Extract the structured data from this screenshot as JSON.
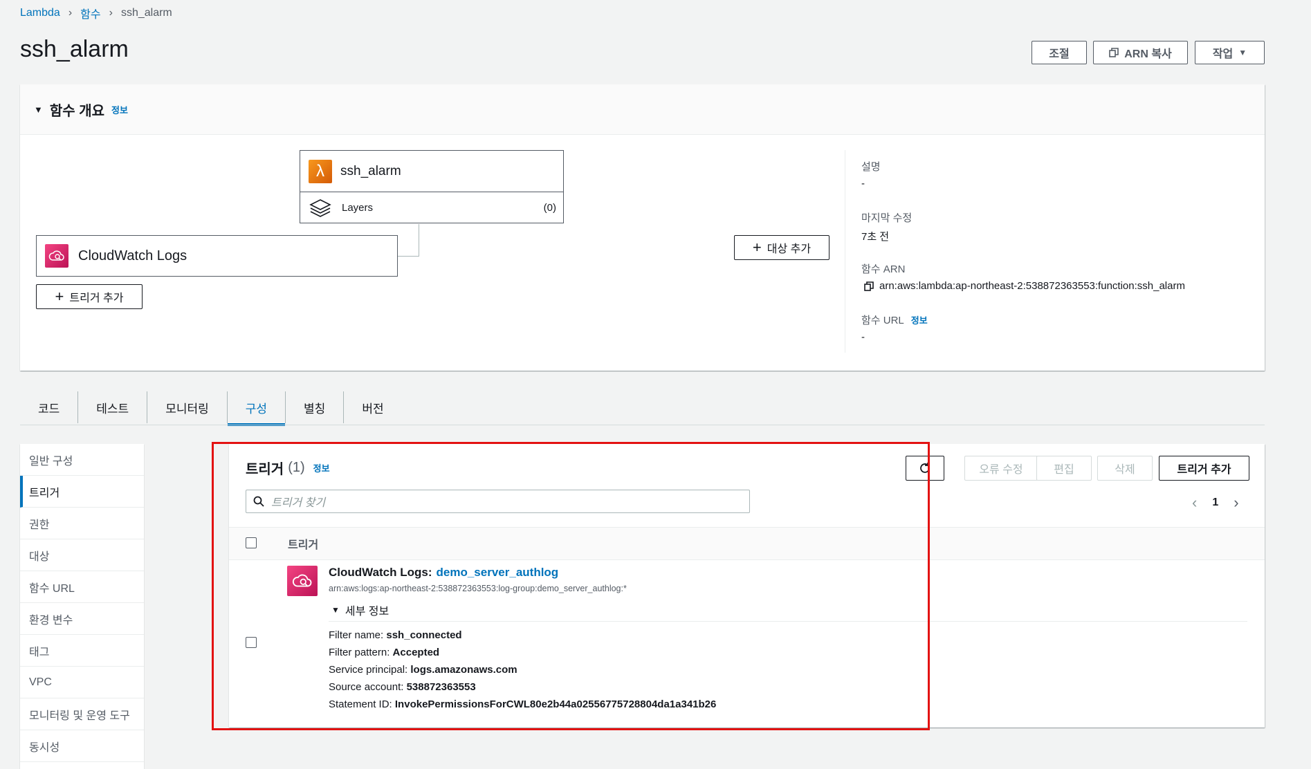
{
  "breadcrumb": {
    "root": "Lambda",
    "section": "함수",
    "current": "ssh_alarm"
  },
  "page_title": "ssh_alarm",
  "header_buttons": {
    "throttle": "조절",
    "copy_arn": "ARN 복사",
    "actions": "작업"
  },
  "overview": {
    "heading": "함수 개요",
    "info": "정보",
    "function_name": "ssh_alarm",
    "layers_label": "Layers",
    "layers_count": "(0)",
    "trigger_name": "CloudWatch Logs",
    "add_trigger": "트리거 추가",
    "add_destination": "대상 추가",
    "meta": {
      "description_label": "설명",
      "description_value": "-",
      "last_modified_label": "마지막 수정",
      "last_modified_value": "7초 전",
      "arn_label": "함수 ARN",
      "arn_value": "arn:aws:lambda:ap-northeast-2:538872363553:function:ssh_alarm",
      "url_label": "함수 URL",
      "url_info": "정보",
      "url_value": "-"
    }
  },
  "tabs": [
    "코드",
    "테스트",
    "모니터링",
    "구성",
    "별칭",
    "버전"
  ],
  "active_tab": "구성",
  "sidebar": [
    "일반 구성",
    "트리거",
    "권한",
    "대상",
    "함수 URL",
    "환경 변수",
    "태그",
    "VPC",
    "모니터링 및 운영 도구",
    "동시성"
  ],
  "triggers": {
    "title": "트리거",
    "count": "(1)",
    "info": "정보",
    "buttons": {
      "fix_errors": "오류 수정",
      "edit": "편집",
      "delete": "삭제",
      "add": "트리거 추가"
    },
    "search_placeholder": "트리거 찾기",
    "page": "1",
    "column_header": "트리거",
    "item": {
      "service": "CloudWatch Logs:",
      "name": "demo_server_authlog",
      "arn": "arn:aws:logs:ap-northeast-2:538872363553:log-group:demo_server_authlog:*",
      "details_toggle": "세부 정보",
      "details": [
        {
          "label": "Filter name:",
          "value": "ssh_connected"
        },
        {
          "label": "Filter pattern:",
          "value": "Accepted"
        },
        {
          "label": "Service principal:",
          "value": "logs.amazonaws.com"
        },
        {
          "label": "Source account:",
          "value": "538872363553"
        },
        {
          "label": "Statement ID:",
          "value": "InvokePermissionsForCWL80e2b44a02556775728804da1a341b26"
        }
      ]
    }
  },
  "colors": {
    "link": "#0073bb",
    "highlight": "#e31212",
    "lambda_orange": "#e7811e",
    "cloudwatch_pink": "#e7157b"
  }
}
